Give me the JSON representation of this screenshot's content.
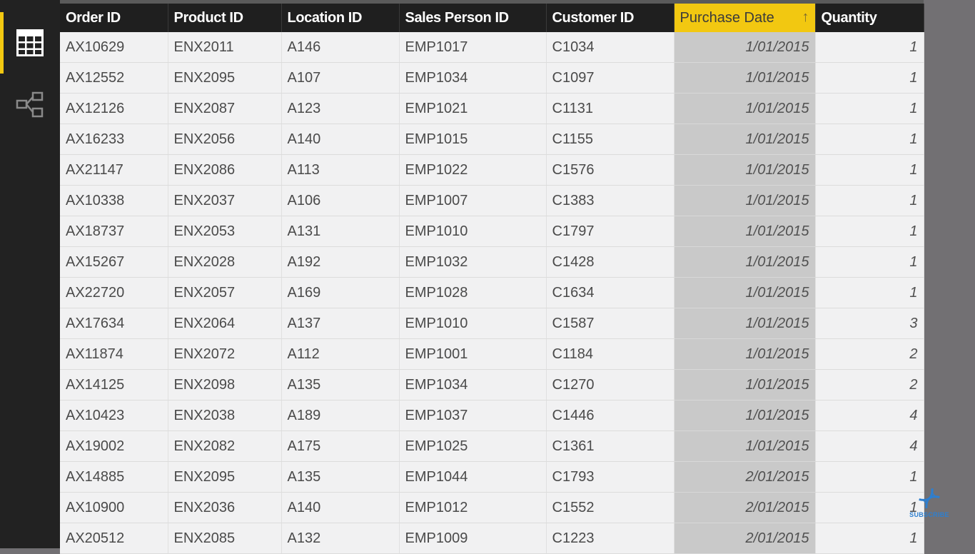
{
  "sidebar": {
    "items": [
      {
        "name": "data-view",
        "icon": "table-icon",
        "active": true
      },
      {
        "name": "relationships-view",
        "icon": "relationships-icon",
        "active": false
      }
    ],
    "accent_color": "#f2c811"
  },
  "table": {
    "columns": [
      {
        "label": "Order ID"
      },
      {
        "label": "Product ID"
      },
      {
        "label": "Location ID"
      },
      {
        "label": "Sales Person ID"
      },
      {
        "label": "Customer ID"
      },
      {
        "label": "Purchase Date",
        "sorted": "ascending",
        "sort_icon": "↑"
      },
      {
        "label": "Quantity"
      }
    ],
    "rows": [
      [
        "AX10629",
        "ENX2011",
        "A146",
        "EMP1017",
        "C1034",
        "1/01/2015",
        "1"
      ],
      [
        "AX12552",
        "ENX2095",
        "A107",
        "EMP1034",
        "C1097",
        "1/01/2015",
        "1"
      ],
      [
        "AX12126",
        "ENX2087",
        "A123",
        "EMP1021",
        "C1131",
        "1/01/2015",
        "1"
      ],
      [
        "AX16233",
        "ENX2056",
        "A140",
        "EMP1015",
        "C1155",
        "1/01/2015",
        "1"
      ],
      [
        "AX21147",
        "ENX2086",
        "A113",
        "EMP1022",
        "C1576",
        "1/01/2015",
        "1"
      ],
      [
        "AX10338",
        "ENX2037",
        "A106",
        "EMP1007",
        "C1383",
        "1/01/2015",
        "1"
      ],
      [
        "AX18737",
        "ENX2053",
        "A131",
        "EMP1010",
        "C1797",
        "1/01/2015",
        "1"
      ],
      [
        "AX15267",
        "ENX2028",
        "A192",
        "EMP1032",
        "C1428",
        "1/01/2015",
        "1"
      ],
      [
        "AX22720",
        "ENX2057",
        "A169",
        "EMP1028",
        "C1634",
        "1/01/2015",
        "1"
      ],
      [
        "AX17634",
        "ENX2064",
        "A137",
        "EMP1010",
        "C1587",
        "1/01/2015",
        "3"
      ],
      [
        "AX11874",
        "ENX2072",
        "A112",
        "EMP1001",
        "C1184",
        "1/01/2015",
        "2"
      ],
      [
        "AX14125",
        "ENX2098",
        "A135",
        "EMP1034",
        "C1270",
        "1/01/2015",
        "2"
      ],
      [
        "AX10423",
        "ENX2038",
        "A189",
        "EMP1037",
        "C1446",
        "1/01/2015",
        "4"
      ],
      [
        "AX19002",
        "ENX2082",
        "A175",
        "EMP1025",
        "C1361",
        "1/01/2015",
        "4"
      ],
      [
        "AX14885",
        "ENX2095",
        "A135",
        "EMP1044",
        "C1793",
        "2/01/2015",
        "1"
      ],
      [
        "AX10900",
        "ENX2036",
        "A140",
        "EMP1012",
        "C1552",
        "2/01/2015",
        "1"
      ],
      [
        "AX20512",
        "ENX2085",
        "A132",
        "EMP1009",
        "C1223",
        "2/01/2015",
        "1"
      ]
    ]
  },
  "overlay": {
    "subscribe_label": "SUBSCRIBE",
    "subscribe_icon": "dna-icon",
    "color": "#2d7fd0"
  }
}
